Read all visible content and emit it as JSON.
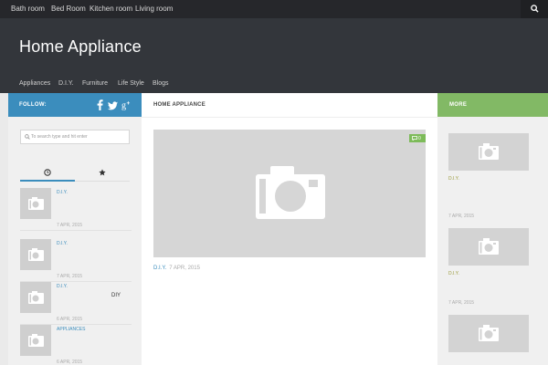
{
  "topnav": {
    "items": [
      "Bath room",
      "Bed Room",
      "Kitchen room",
      "Living room"
    ],
    "search_icon": "search-icon"
  },
  "header": {
    "title": "Home Appliance",
    "nav": [
      "Appliances",
      "D.I.Y.",
      "Furniture",
      "Life Style",
      "Blogs"
    ]
  },
  "sidebar_left": {
    "follow_label": "FOLLOW:",
    "social_icons": [
      "facebook-icon",
      "twitter-icon",
      "google-plus-icon"
    ],
    "search_placeholder": "To search type and hit enter",
    "tabs": [
      "clock-icon",
      "star-icon"
    ],
    "posts": [
      {
        "category": "D.I.Y.",
        "date": "7 APR, 2015"
      },
      {
        "category": "D.I.Y.",
        "date": "7 APR, 2015"
      },
      {
        "category": "D.I.Y.",
        "date": "6 APR, 2015"
      },
      {
        "category": "APPLIANCES",
        "date": "6 APR, 2015"
      }
    ],
    "stray_text": "DIY"
  },
  "main": {
    "heading": "HOME APPLIANCE",
    "featured": {
      "comments": "0",
      "category": "D.I.Y.",
      "date": "7 APR, 2015"
    }
  },
  "sidebar_right": {
    "more_label": "MORE",
    "items": [
      {
        "category": "D.I.Y.",
        "date": "7 APR, 2015"
      },
      {
        "category": "D.I.Y.",
        "date": "7 APR, 2015"
      },
      {
        "category": "",
        "date": ""
      }
    ]
  },
  "colors": {
    "accent_blue": "#3b8dbd",
    "accent_green": "#82b965",
    "header_dark": "#33363b",
    "topbar_dark": "#26272b"
  }
}
